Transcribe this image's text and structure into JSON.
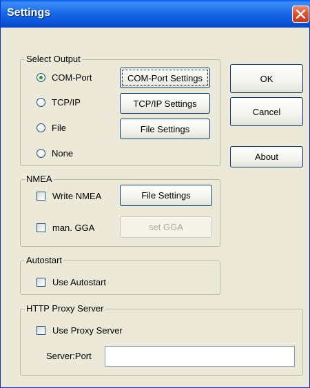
{
  "window": {
    "title": "Settings"
  },
  "select_output": {
    "legend": "Select Output",
    "options": [
      {
        "label": "COM-Port",
        "checked": true,
        "settings_button": "COM-Port Settings"
      },
      {
        "label": "TCP/IP",
        "checked": false,
        "settings_button": "TCP/IP Settings"
      },
      {
        "label": "File",
        "checked": false,
        "settings_button": "File Settings"
      },
      {
        "label": "None",
        "checked": false
      }
    ]
  },
  "nmea": {
    "legend": "NMEA",
    "write_nmea": {
      "label": "Write NMEA",
      "checked": false,
      "button": "File Settings"
    },
    "man_gga": {
      "label": "man. GGA",
      "checked": false,
      "button": "set GGA",
      "button_enabled": false
    }
  },
  "autostart": {
    "legend": "Autostart",
    "use_autostart": {
      "label": "Use Autostart",
      "checked": false
    }
  },
  "proxy": {
    "legend": "HTTP Proxy Server",
    "use_proxy": {
      "label": "Use Proxy Server",
      "checked": false
    },
    "server_port_label": "Server:Port",
    "server_port_value": ""
  },
  "actions": {
    "ok": "OK",
    "cancel": "Cancel",
    "about": "About"
  },
  "colors": {
    "titlebar": "#0a5ee8",
    "face": "#ece9d8",
    "close": "#e0502c",
    "radio_dot": "#21a121"
  }
}
